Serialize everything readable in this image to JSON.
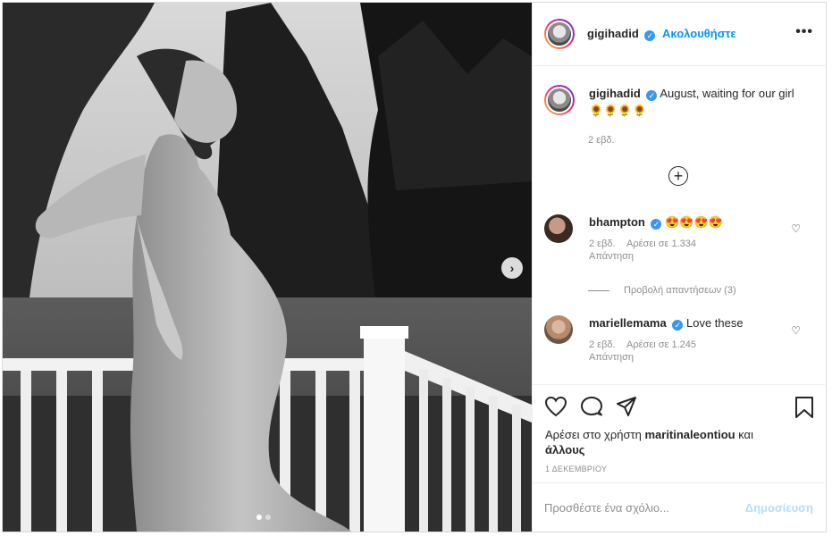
{
  "post": {
    "carousel": {
      "slide_count": 2,
      "active_slide": 1,
      "next_icon": "chevron-right-icon"
    }
  },
  "header": {
    "username": "gigihadid",
    "verified_icon": "verified-badge-icon",
    "separator": "•",
    "follow_label": "Ακολουθήστε",
    "more_icon": "more-options-icon",
    "more_label": "•••"
  },
  "caption": {
    "username": "gigihadid",
    "text": "August, waiting for our girl 🌻🌻🌻🌻",
    "time": "2 εβδ.",
    "load_more_label": "+"
  },
  "comments": [
    {
      "username": "bhampton",
      "text": "😍😍😍😍",
      "time": "2 εβδ.",
      "likes": "Αρέσει σε 1.334",
      "reply_label": "Απάντηση",
      "view_replies": "Προβολή απαντήσεων (3)"
    },
    {
      "username": "mariellemama",
      "text": "Love these",
      "time": "2 εβδ.",
      "likes": "Αρέσει σε 1.245",
      "reply_label": "Απάντηση"
    }
  ],
  "actions": {
    "icons": [
      "heart-icon",
      "comment-icon",
      "share-icon",
      "bookmark-icon"
    ],
    "likes_prefix": "Αρέσει στο χρήστη",
    "likes_user": "maritinaleontiou",
    "likes_suffix": "και",
    "likes_others": "άλλους",
    "date": "1 ΔΕΚΕΜΒΡΙΟΥ"
  },
  "add_comment": {
    "placeholder": "Προσθέστε ένα σχόλιο...",
    "post_label": "Δημοσίευση"
  },
  "colors": {
    "accent": "#0095f6",
    "verified": "#3897f0",
    "muted": "#8e8e8e",
    "post_disabled": "#b2dffc"
  }
}
